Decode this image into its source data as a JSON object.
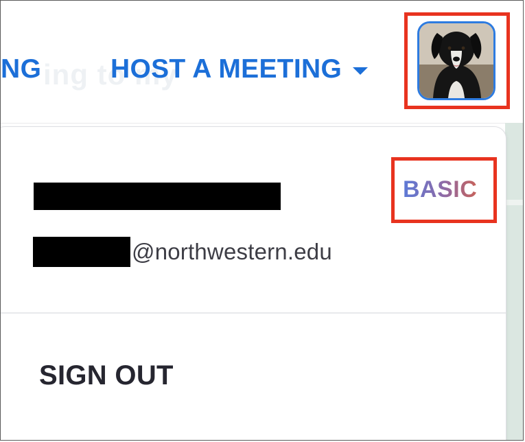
{
  "topbar": {
    "partial_nav_label": "NG",
    "background_text": "ing to my",
    "host_menu_label": "HOST A MEETING",
    "host_menu_icon": "caret-down-icon",
    "avatar_alt": "profile-avatar"
  },
  "dropdown": {
    "name": "",
    "email_domain": "@northwestern.edu",
    "plan_badge": "BASIC",
    "sign_out_label": "SIGN OUT"
  },
  "colors": {
    "nav_blue": "#1c6fd8",
    "highlight_red": "#e8331f",
    "avatar_border": "#2d7be0",
    "text_dark": "#262630",
    "page_green": "#dbe7e1"
  }
}
